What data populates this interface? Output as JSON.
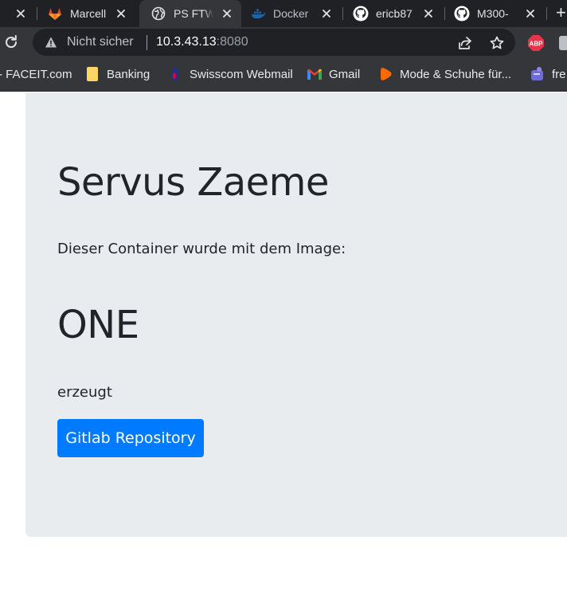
{
  "browser": {
    "tabs": [
      {
        "title": "",
        "favicon": "globe-icon"
      },
      {
        "title": "Marcell",
        "favicon": "gitlab-icon"
      },
      {
        "title": "PS FTW",
        "favicon": "globe-icon",
        "active": true
      },
      {
        "title": "Docker",
        "favicon": "docker-icon"
      },
      {
        "title": "ericb87",
        "favicon": "github-icon"
      },
      {
        "title": "M300-",
        "favicon": "github-icon"
      }
    ],
    "new_tab_label": "+",
    "omnibox": {
      "security_label": "Nicht sicher",
      "host": "10.3.43.13",
      "port": ":8080"
    },
    "extension_abp_label": "ABP",
    "bookmarks": [
      {
        "label": "- FACEIT.com",
        "icon": ""
      },
      {
        "label": "Banking",
        "icon": "folder-icon"
      },
      {
        "label": "Swisscom Webmail",
        "icon": "swisscom-icon"
      },
      {
        "label": "Gmail",
        "icon": "gmail-icon"
      },
      {
        "label": "Mode & Schuhe für...",
        "icon": "zalando-icon"
      },
      {
        "label": "fre",
        "icon": "puzzle-icon"
      }
    ]
  },
  "page": {
    "title": "Servus Zaeme",
    "lead": "Dieser Container wurde mit dem Image:",
    "image_name": "ONE",
    "suffix": "erzeugt",
    "button_label": "Gitlab Repository"
  },
  "colors": {
    "accent": "#007bff",
    "jumbotron_bg": "#e9ecef",
    "text": "#212529",
    "browser_frame": "#202124",
    "browser_toolbar": "#35363a"
  }
}
